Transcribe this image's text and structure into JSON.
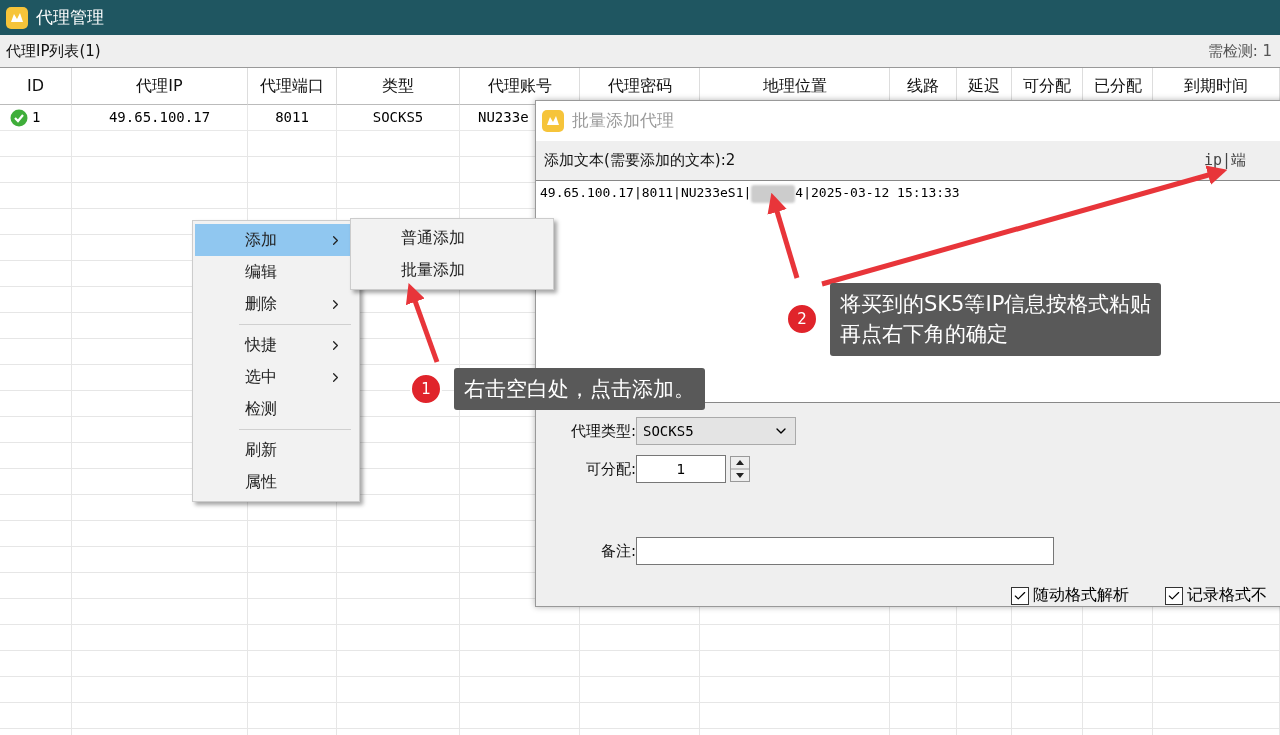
{
  "window": {
    "title": "代理管理"
  },
  "toolbar": {
    "list_title": "代理IP列表(1)",
    "pending": "需检测: 1"
  },
  "table": {
    "columns": [
      "ID",
      "代理IP",
      "代理端口",
      "类型",
      "代理账号",
      "代理密码",
      "地理位置",
      "线路",
      "延迟",
      "可分配",
      "已分配",
      "到期时间"
    ],
    "rows": [
      {
        "ok": true,
        "cells": [
          "1",
          "49.65.100.17",
          "8011",
          "SOCKS5",
          "NU233e"
        ]
      }
    ]
  },
  "context_menu": {
    "items": [
      {
        "kind": "item",
        "label": "添加",
        "has_submenu": true,
        "selected": true
      },
      {
        "kind": "item",
        "label": "编辑",
        "has_submenu": false,
        "selected": false
      },
      {
        "kind": "item",
        "label": "删除",
        "has_submenu": true,
        "selected": false
      },
      {
        "kind": "separator"
      },
      {
        "kind": "item",
        "label": "快捷",
        "has_submenu": true,
        "selected": false
      },
      {
        "kind": "item",
        "label": "选中",
        "has_submenu": true,
        "selected": false
      },
      {
        "kind": "item",
        "label": "检测",
        "has_submenu": false,
        "selected": false
      },
      {
        "kind": "separator"
      },
      {
        "kind": "item",
        "label": "刷新",
        "has_submenu": false,
        "selected": false
      },
      {
        "kind": "item",
        "label": "属性",
        "has_submenu": false,
        "selected": false
      }
    ],
    "submenu": [
      "普通添加",
      "批量添加"
    ]
  },
  "dialog": {
    "title": "批量添加代理",
    "text_label": "添加文本(需要添加的文本):2",
    "format_hint": "ip|端",
    "text_parts": [
      "49.65.100.17|8011|NU233eS1|",
      "4|2025-03-12 15:13:33"
    ],
    "proxy_type_label": "代理类型:",
    "proxy_type": "SOCKS5",
    "assignable_label": "可分配:",
    "assignable": "1",
    "note_label": "备注:",
    "checkboxes": [
      {
        "label": "随动格式解析",
        "checked": true
      },
      {
        "label": "记录格式不",
        "checked": true
      }
    ]
  },
  "callouts": [
    {
      "number": "1",
      "lines": [
        "右击空白处，点击添加。"
      ]
    },
    {
      "number": "2",
      "lines": [
        "将买到的SK5等IP信息按格式粘贴",
        "再点右下角的确定"
      ]
    }
  ]
}
